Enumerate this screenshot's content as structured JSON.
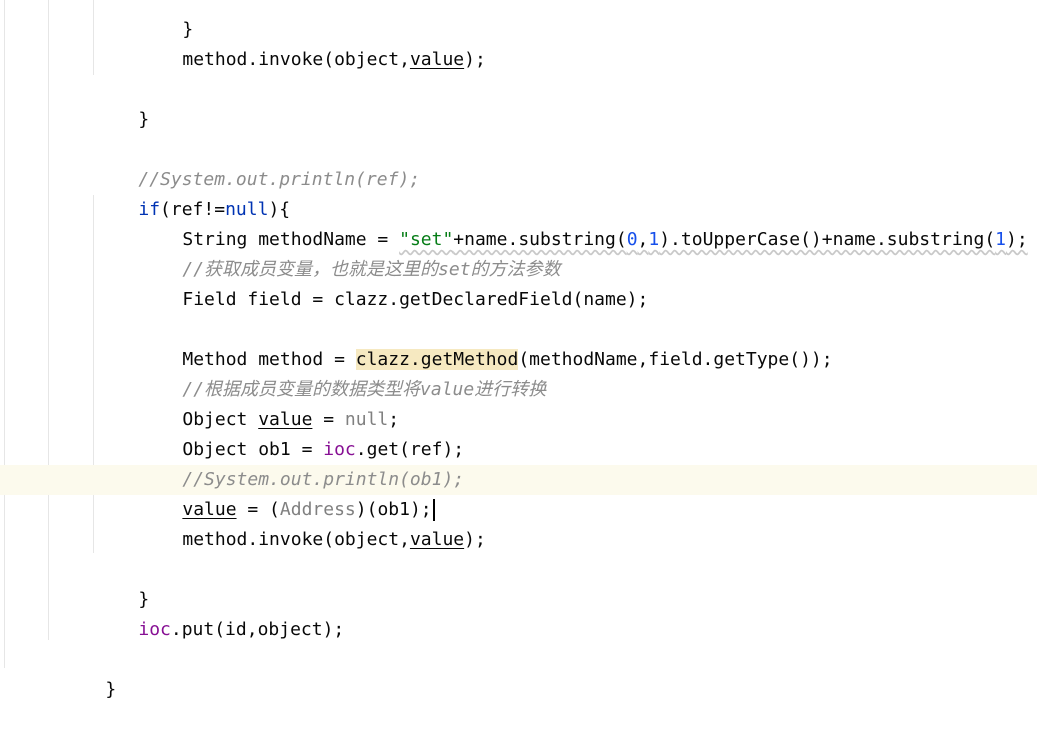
{
  "editor": {
    "lines": {
      "l0": {
        "brace": "}"
      },
      "l1": {
        "a": "method.invoke(object,",
        "b": "value",
        "c": ");"
      },
      "l3": {
        "brace": "}"
      },
      "l5": {
        "comment": "//System.out.println(ref);"
      },
      "l6": {
        "kw_if": "if",
        "a": "(ref!=",
        "kw_null": "null",
        "b": "){"
      },
      "l7": {
        "a": "String methodName = ",
        "str": "\"set\"",
        "b": "+name.substring(",
        "n0": "0",
        "c": ",",
        "n1": "1",
        "d": ").toUpperCase()+name.substring(",
        "n2": "1",
        "e": ");"
      },
      "l8": {
        "comment": "//获取成员变量，也就是这里的set的方法参数"
      },
      "l9": {
        "a": "Field field = clazz.getDeclaredField(name);"
      },
      "l11": {
        "a": "Method method = ",
        "hl": "clazz.getMethod",
        "b": "(methodName,field.getType());"
      },
      "l12": {
        "comment": "//根据成员变量的数据类型将value进行转换"
      },
      "l13": {
        "a": "Object ",
        "b": "value",
        "c": " = ",
        "kw_null": "null",
        "d": ";"
      },
      "l14": {
        "a": "Object ob1 = ",
        "field": "ioc",
        "b": ".get(ref);"
      },
      "l15": {
        "comment": "//System.out.println(ob1);"
      },
      "l16": {
        "a": "value",
        "b": " = (",
        "cast": "Address",
        "c": ")(ob1);"
      },
      "l17": {
        "a": "method.invoke(object,",
        "b": "value",
        "c": ");"
      },
      "l19": {
        "brace": "}"
      },
      "l20": {
        "field": "ioc",
        "a": ".put(id,object);"
      },
      "l22": {
        "brace": "}"
      }
    }
  }
}
